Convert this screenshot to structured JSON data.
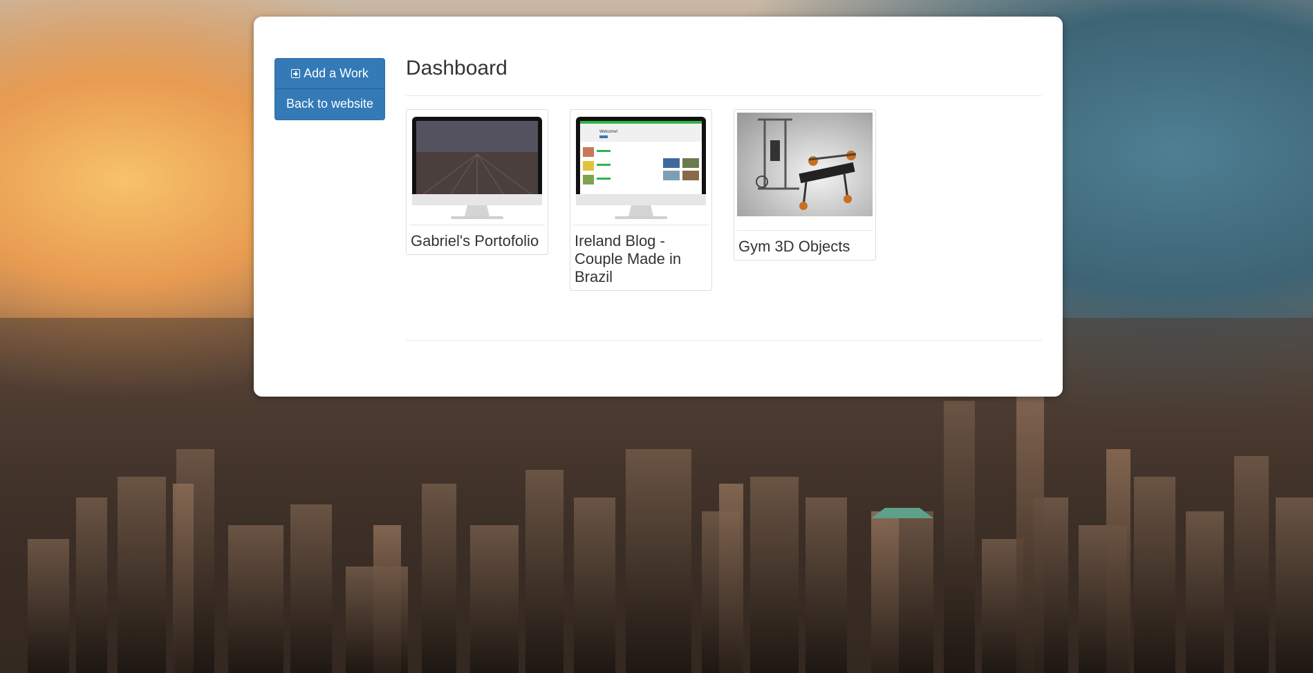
{
  "sidebar": {
    "add_work_label": "Add a Work",
    "back_label": "Back to website"
  },
  "main": {
    "title": "Dashboard",
    "works": [
      {
        "title": "Gabriel's Portofolio",
        "thumbnail": "imac-dark-landscape"
      },
      {
        "title": "Ireland Blog - Couple Made in Brazil",
        "thumbnail": "imac-blog-welcome"
      },
      {
        "title": "Gym 3D Objects",
        "thumbnail": "gym-equipment-render"
      }
    ],
    "blog_preview_text": "Welcome!"
  },
  "colors": {
    "primary_button": "#337ab7",
    "panel": "#ffffff",
    "text": "#333333"
  }
}
